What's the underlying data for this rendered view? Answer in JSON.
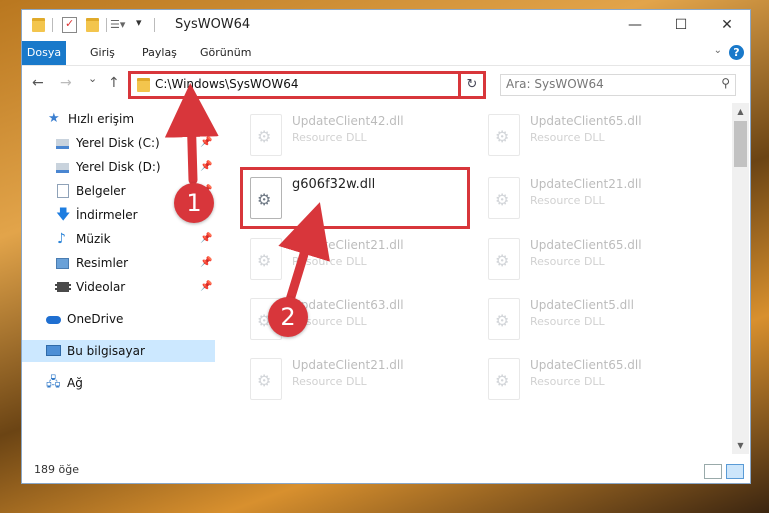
{
  "window": {
    "title": "SysWOW64",
    "controls": {
      "minimize": "—",
      "maximize": "☐",
      "close": "✕"
    }
  },
  "ribbon": {
    "tabs": [
      "Dosya",
      "Giriş",
      "Paylaş",
      "Görünüm"
    ],
    "help": "?"
  },
  "nav": {
    "back": "←",
    "forward": "→",
    "recent": "⌄",
    "up": "↑",
    "address": "C:\\Windows\\SysWOW64",
    "dropdown": "⌄",
    "refresh": "↻",
    "search_placeholder": "Ara: SysWOW64"
  },
  "sidebar": {
    "items": [
      {
        "label": "Hızlı erişim",
        "icon": "star-icon",
        "pinned": false
      },
      {
        "label": "Yerel Disk (C:)",
        "icon": "drive-icon",
        "pinned": true
      },
      {
        "label": "Yerel Disk (D:)",
        "icon": "drive-icon",
        "pinned": true
      },
      {
        "label": "Belgeler",
        "icon": "document-icon",
        "pinned": true
      },
      {
        "label": "İndirmeler",
        "icon": "download-icon",
        "pinned": true
      },
      {
        "label": "Müzik",
        "icon": "music-icon",
        "pinned": true
      },
      {
        "label": "Resimler",
        "icon": "pictures-icon",
        "pinned": true
      },
      {
        "label": "Videolar",
        "icon": "video-icon",
        "pinned": true
      },
      {
        "label": "OneDrive",
        "icon": "cloud-icon",
        "pinned": false
      },
      {
        "label": "Bu bilgisayar",
        "icon": "computer-icon",
        "pinned": false,
        "selected": true
      },
      {
        "label": "Ağ",
        "icon": "network-icon",
        "pinned": false
      }
    ]
  },
  "files": {
    "left": [
      {
        "name": "UpdateClient42.dll",
        "type": "Resource DLL"
      },
      {
        "name": "g606f32w.dll",
        "type": ""
      },
      {
        "name": "UpdateClient21.dll",
        "type": "Resource DLL"
      },
      {
        "name": "UpdateClient63.dll",
        "type": "Resource DLL"
      },
      {
        "name": "UpdateClient21.dll",
        "type": "Resource DLL"
      }
    ],
    "right": [
      {
        "name": "UpdateClient65.dll",
        "type": "Resource DLL"
      },
      {
        "name": "UpdateClient21.dll",
        "type": "Resource DLL"
      },
      {
        "name": "UpdateClient65.dll",
        "type": "Resource DLL"
      },
      {
        "name": "UpdateClient5.dll",
        "type": "Resource DLL"
      },
      {
        "name": "UpdateClient65.dll",
        "type": "Resource DLL"
      }
    ]
  },
  "status": {
    "item_count": "189 öğe"
  },
  "annotations": {
    "step1": "1",
    "step2": "2"
  },
  "colors": {
    "accent": "#1979ca",
    "highlight": "#d8363b",
    "selected": "#cce8ff"
  }
}
